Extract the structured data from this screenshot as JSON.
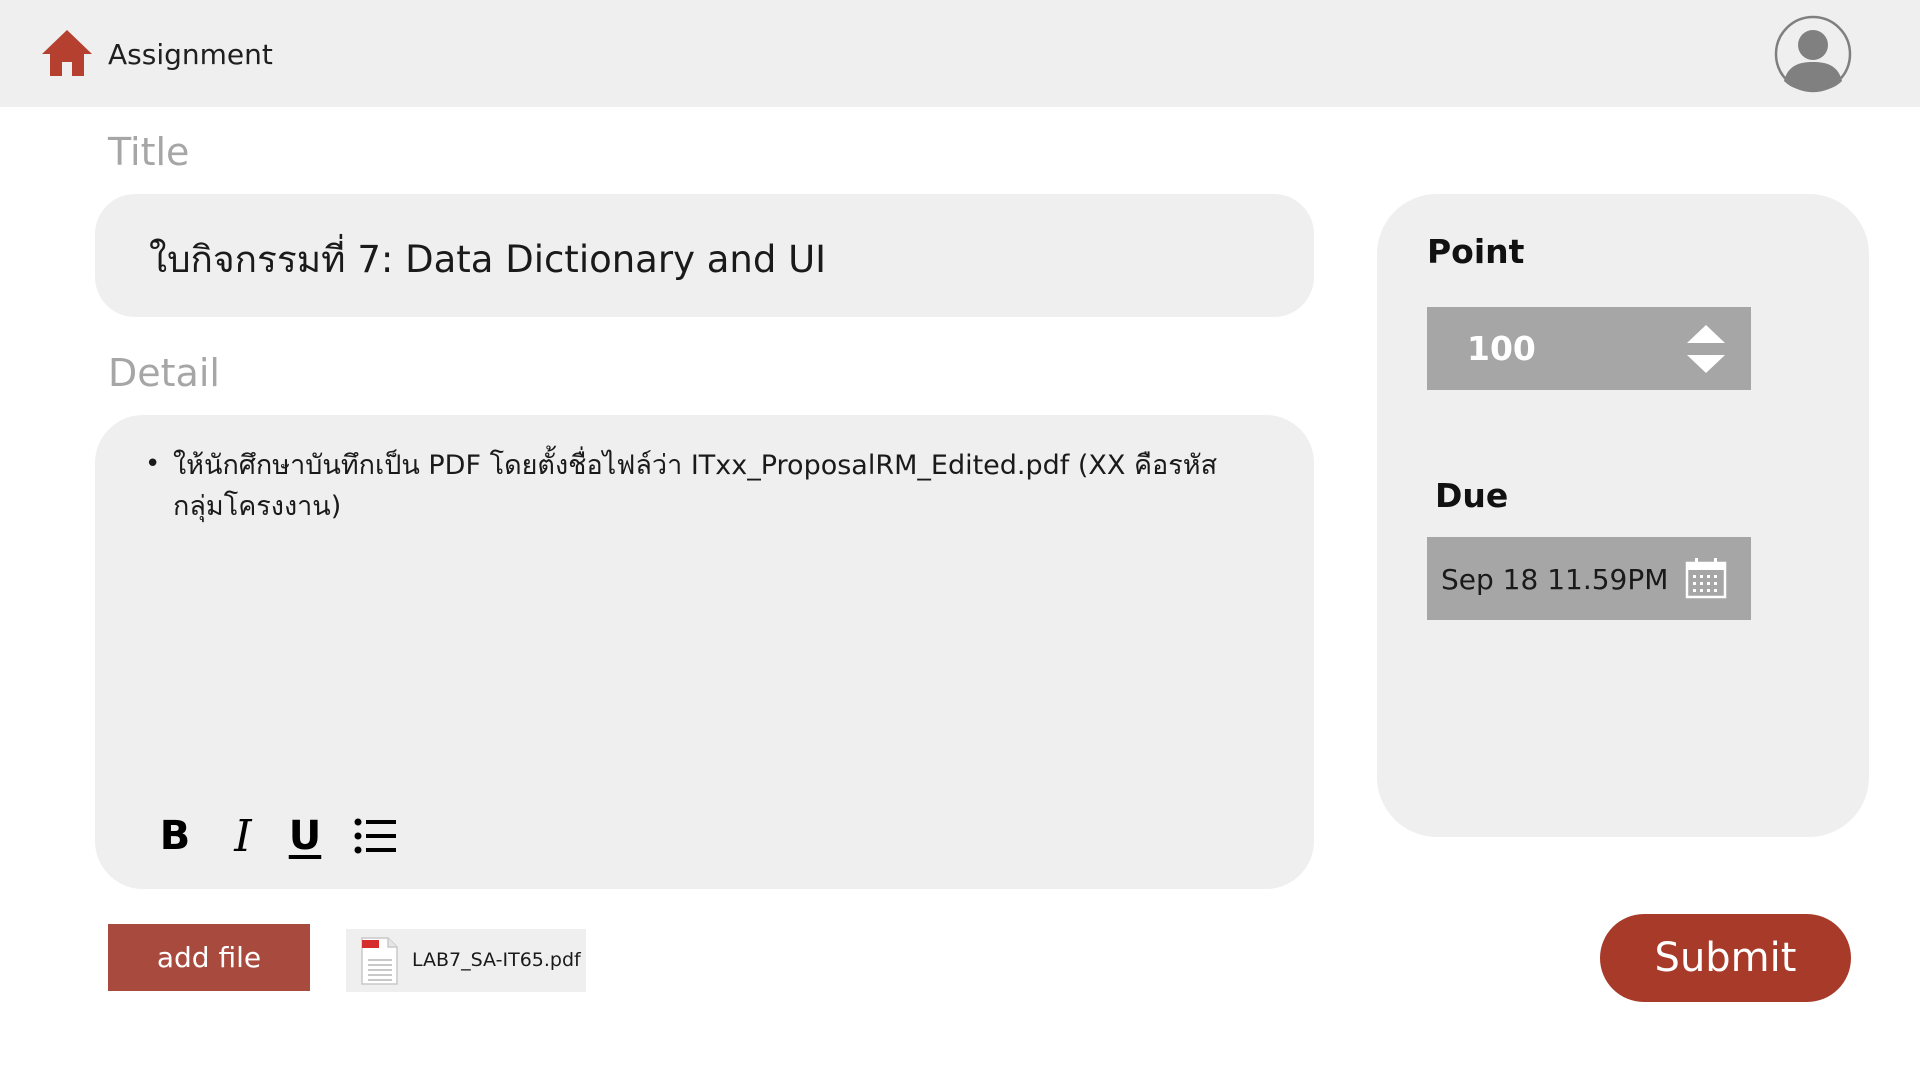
{
  "header": {
    "title": "Assignment",
    "home_icon": "home-icon",
    "avatar_icon": "user-avatar-icon",
    "accent_color": "#a83a2a"
  },
  "form": {
    "title_label": "Title",
    "title_value": "ใบกิจกรรมที่ 7: Data Dictionary and UI",
    "detail_label": "Detail",
    "detail_items": [
      "ให้นักศึกษาบันทึกเป็น PDF โดยตั้งชื่อไฟล์ว่า ITxx_ProposalRM_Edited.pdf (XX คือรหัสกลุ่มโครงงาน)"
    ],
    "toolbar": {
      "bold": "B",
      "italic": "I",
      "underline": "U",
      "list_icon": "bulleted-list-icon"
    }
  },
  "side_panel": {
    "point_label": "Point",
    "point_value": "100",
    "due_label": "Due",
    "due_value": "Sep 18 11.59PM",
    "calendar_icon": "calendar-icon"
  },
  "actions": {
    "add_file_label": "add file",
    "attached_file": "LAB7_SA-IT65.pdf",
    "file_icon": "pdf-file-icon",
    "submit_label": "Submit"
  }
}
